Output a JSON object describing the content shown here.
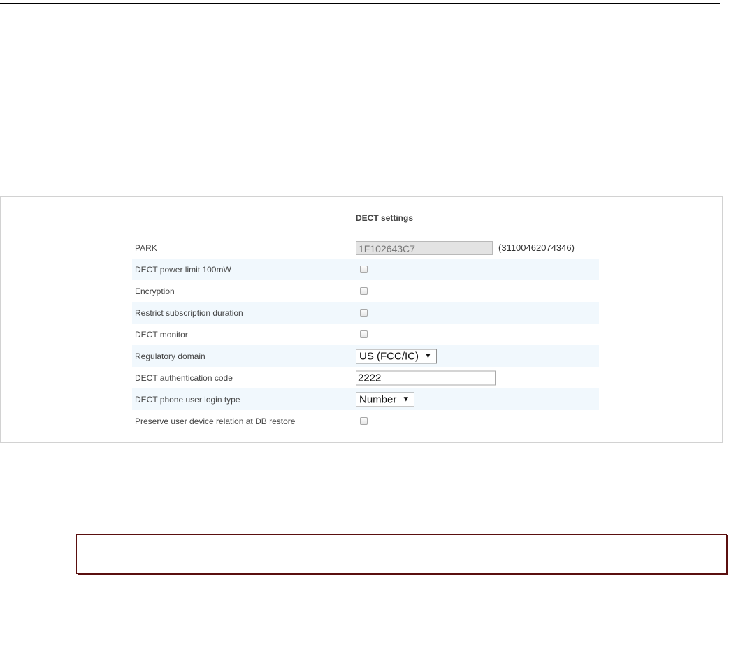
{
  "section_title": "DECT settings",
  "rows": [
    {
      "label": "PARK",
      "control": "readonly",
      "value": "1F102643C7",
      "extra": "(31100462074346)"
    },
    {
      "label": "DECT power limit 100mW",
      "control": "checkbox",
      "checked": false
    },
    {
      "label": "Encryption",
      "control": "checkbox",
      "checked": false
    },
    {
      "label": "Restrict subscription duration",
      "control": "checkbox",
      "checked": false
    },
    {
      "label": "DECT monitor",
      "control": "checkbox",
      "checked": false
    },
    {
      "label": "Regulatory domain",
      "control": "select",
      "value": "US (FCC/IC)"
    },
    {
      "label": "DECT authentication code",
      "control": "text",
      "value": "2222"
    },
    {
      "label": "DECT phone user login type",
      "control": "select",
      "value": "Number"
    },
    {
      "label": "Preserve user device relation at DB restore",
      "control": "checkbox",
      "checked": false
    }
  ]
}
